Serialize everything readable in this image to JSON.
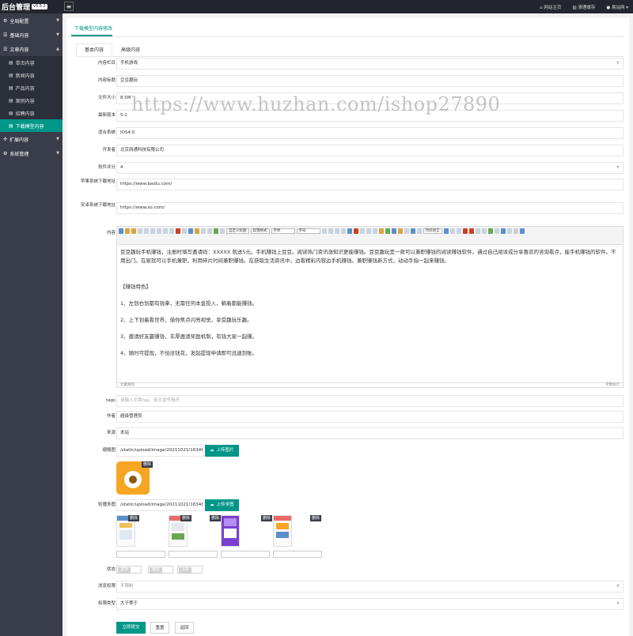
{
  "app": {
    "title": "后台管理",
    "version": "v5.5.2"
  },
  "topbar": {
    "links": [
      "网站主页",
      "清理缓存",
      "易站网"
    ]
  },
  "sidebar": {
    "items": [
      {
        "label": "全局配置",
        "icon": "gear-icon"
      },
      {
        "label": "基础内容",
        "icon": "menu-icon"
      },
      {
        "label": "文章内容",
        "icon": "menu-icon"
      }
    ],
    "subitems": [
      "单页内容",
      "新闻内容",
      "产品内容",
      "案例内容",
      "招聘内容",
      "下载模型内容"
    ],
    "items2": [
      {
        "label": "扩展内容",
        "icon": "expand-icon"
      },
      {
        "label": "系统管理",
        "icon": "gear-icon"
      }
    ]
  },
  "page": {
    "title": "下载模型内容修改",
    "tabs": [
      "基本内容",
      "高级内容"
    ]
  },
  "form": {
    "category": {
      "label": "内容栏目",
      "value": "手机游戏"
    },
    "title": {
      "label": "内容标题",
      "value": "豆豆趣玩"
    },
    "size": {
      "label": "文件大小",
      "value": "8.5M"
    },
    "version": {
      "label": "最新版本",
      "value": "5.1"
    },
    "system": {
      "label": "适合系统",
      "value": "IOS4.0"
    },
    "developer": {
      "label": "开发者",
      "value": "北京网通科技有限公司"
    },
    "rating": {
      "label": "软件评分",
      "value": "4"
    },
    "apple_url": {
      "label": "苹果系统下载地址",
      "value": "https://www.baidu.com/"
    },
    "android_url": {
      "label": "安卓系统下载地址",
      "value": "https://www.so.com/"
    },
    "content": {
      "label": "内容",
      "toolbar_selects": [
        "代码语言",
        "自定义标题",
        "段落格式",
        "字体",
        "字号"
      ],
      "paragraphs": [
        "豆豆趣玩手机赚钱，注册时填写邀请码：XXXXX 就送5元。手机赚钱上豆豆。阅读热门资讯涨知识更能赚钱。豆豆趣玩是一款可以兼职赚钱的阅读赚钱软件。通过自己阅读或分享喜欢的咨询看点，能手机赚钱的软件。不用出门。在家就可以手机兼职，利用碎片时间兼职赚钱。在获取生活资讯中，边看精彩内容边手机赚钱。兼职赚钱新方式，动动手指一起来赚钱。",
        "【赚钱特色】",
        "1、左划右划都有钱拿，无需任何本金投入，躺着都能赚钱。",
        "2、上下划着看世界，借你焦点闪亮视觉，享受趣玩乐趣。",
        "3、邀请好友赢赚钱，丰厚邀请奖励机制，有钱大家一起赚。",
        "4、随时可提现，不怕没钱花，发起提现申请即可迅速到账。"
      ],
      "footer_left": "元素路径",
      "footer_right": "字数统计"
    },
    "tags": {
      "label": "tags",
      "placeholder": "请输入文章tag，英文逗号隔开"
    },
    "author": {
      "label": "作者",
      "value": "超级管理员"
    },
    "source": {
      "label": "来源",
      "value": "本站"
    },
    "thumbnail": {
      "label": "缩略图",
      "value": "/static/upload/image/20211021/163482",
      "button": "上传图片",
      "delete": "删除"
    },
    "gallery": {
      "label": "轮播多图",
      "value": "/static/upload/image/20211021/163482",
      "button": "上传多图",
      "delete": "删除"
    },
    "status": {
      "label": "状态",
      "switches": [
        "置顶",
        "推荐",
        "头条"
      ]
    },
    "permission": {
      "label": "浏览权限",
      "value": "不限制"
    },
    "permission_type": {
      "label": "权限类型",
      "value": "大于等于"
    },
    "buttons": {
      "submit": "立即提交",
      "reset": "重置",
      "back": "返回"
    }
  },
  "watermark": "https://www.huzhan.com/ishop27890",
  "colors": {
    "accent": "#009688",
    "sidebar": "#393d49",
    "topbar": "#23262e"
  }
}
